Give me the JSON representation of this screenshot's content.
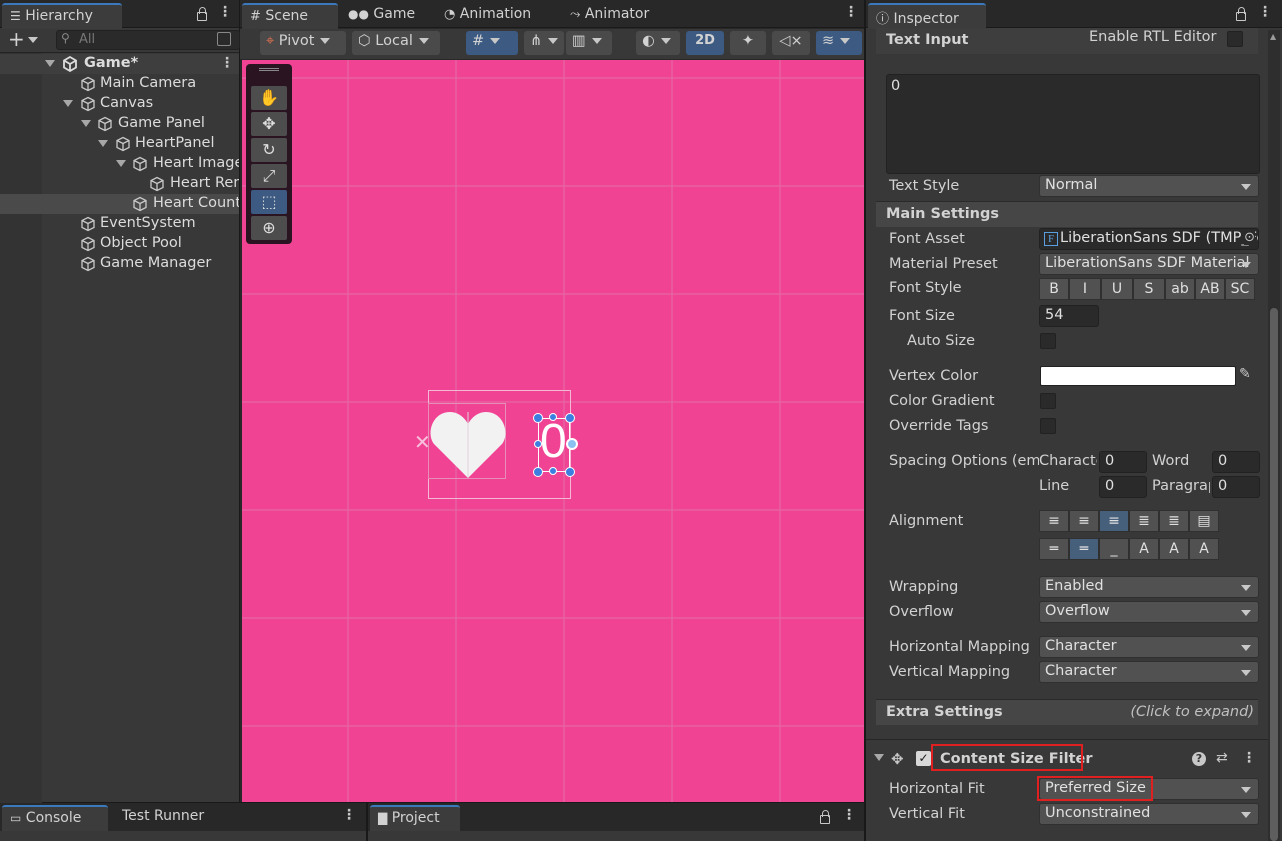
{
  "hierarchy": {
    "tab_label": "Hierarchy",
    "search_placeholder": "All",
    "scene_name": "Game*",
    "items": [
      {
        "label": "Main Camera"
      },
      {
        "label": "Canvas"
      },
      {
        "label": "Game Panel"
      },
      {
        "label": "HeartPanel"
      },
      {
        "label": "Heart Image"
      },
      {
        "label": "Heart Renderer"
      },
      {
        "label": "Heart Counter"
      },
      {
        "label": "EventSystem"
      },
      {
        "label": "Object Pool"
      },
      {
        "label": "Game Manager"
      }
    ]
  },
  "scene": {
    "tabs": [
      "Scene",
      "Game",
      "Animation",
      "Animator"
    ],
    "pivot_label": "Pivot",
    "local_label": "Local",
    "mode_2d_label": "2D",
    "background_color": "#f04394",
    "counter_text": "0"
  },
  "inspector": {
    "tab_label": "Inspector",
    "text_input_header": "Text Input",
    "rtl_label": "Enable RTL Editor",
    "text_value": "0",
    "text_style_label": "Text Style",
    "text_style_value": "Normal",
    "main_settings_header": "Main Settings",
    "font_asset_label": "Font Asset",
    "font_asset_value": "LiberationSans SDF (TMP_FontAsset)",
    "material_preset_label": "Material Preset",
    "material_preset_value": "LiberationSans SDF Material",
    "font_style_label": "Font Style",
    "font_style_buttons": [
      "B",
      "I",
      "U",
      "S",
      "ab",
      "AB",
      "SC"
    ],
    "font_size_label": "Font Size",
    "font_size_value": "54",
    "auto_size_label": "Auto Size",
    "vertex_color_label": "Vertex Color",
    "color_gradient_label": "Color Gradient",
    "override_tags_label": "Override Tags",
    "spacing_label": "Spacing Options (em)",
    "spacing_character_label": "Character",
    "spacing_character_value": "0",
    "spacing_word_label": "Word",
    "spacing_word_value": "0",
    "spacing_line_label": "Line",
    "spacing_line_value": "0",
    "spacing_paragraph_label": "Paragraph",
    "spacing_paragraph_value": "0",
    "alignment_label": "Alignment",
    "wrapping_label": "Wrapping",
    "wrapping_value": "Enabled",
    "overflow_label": "Overflow",
    "overflow_value": "Overflow",
    "hmapping_label": "Horizontal Mapping",
    "hmapping_value": "Character",
    "vmapping_label": "Vertical Mapping",
    "vmapping_value": "Character",
    "extra_settings_header": "Extra Settings",
    "extra_settings_hint": "(Click to expand)",
    "csf_header": "Content Size Filter",
    "horizontal_fit_label": "Horizontal Fit",
    "horizontal_fit_value": "Preferred Size",
    "vertical_fit_label": "Vertical Fit",
    "vertical_fit_value": "Unconstrained",
    "highlight_color": "#e02020"
  },
  "bottom": {
    "console_tab": "Console",
    "test_runner_tab": "Test Runner",
    "project_tab": "Project"
  }
}
